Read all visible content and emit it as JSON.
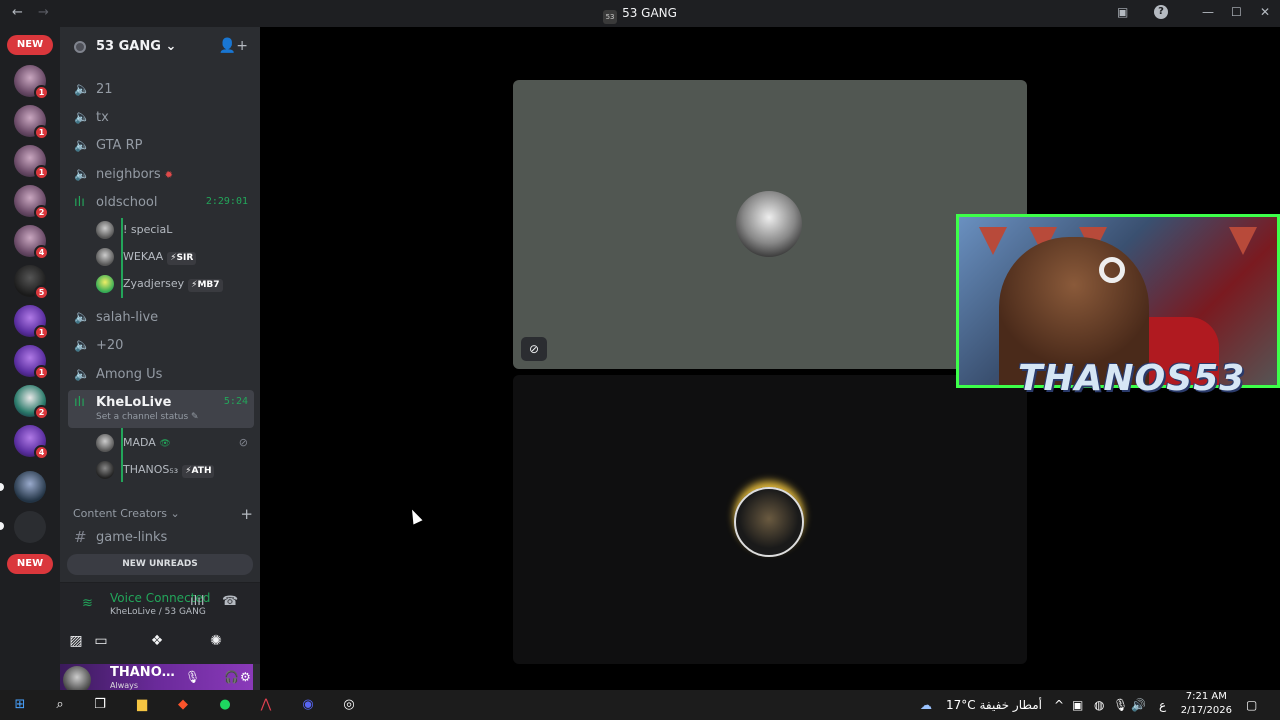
{
  "window": {
    "title": "53 GANG",
    "title_glyph": "53",
    "back": "←",
    "forward": "→",
    "minimize": "—",
    "maximize": "☐",
    "close": "✕",
    "inbox_icon": "▣",
    "help_icon": "?"
  },
  "guilds": {
    "new_label": "NEW",
    "badges": [
      "1",
      "1",
      "1",
      "2",
      "4",
      "5",
      "1",
      "1",
      "2",
      "4"
    ]
  },
  "server": {
    "name": "53 GANG",
    "caret": "⌄",
    "invite_icon": "👤+"
  },
  "channels": [
    {
      "name": "21"
    },
    {
      "name": "tx"
    },
    {
      "name": "GTA RP"
    },
    {
      "name": "neighbors",
      "emoji": "✹"
    },
    {
      "name": "oldschool",
      "timer": "2:29:01",
      "live": true
    },
    {
      "name": "salah-live"
    },
    {
      "name": "+20"
    },
    {
      "name": "Among Us"
    },
    {
      "name": "KheLoLive",
      "timer": "5:24",
      "live": true,
      "status": "Set a channel status ✎"
    }
  ],
  "oldschool_users": [
    {
      "name": "! speciaL",
      "tag": ""
    },
    {
      "name": "WEKAA",
      "tag": "⚡SIR"
    },
    {
      "name": "Zyadjersey",
      "tag": "⚡MB7"
    }
  ],
  "khelolive_users": [
    {
      "name": "MADA",
      "suffix": "👁",
      "tag": "",
      "muted": true
    },
    {
      "name": "THANOS₅₃",
      "tag": "⚡ATH"
    }
  ],
  "category": {
    "name": "Content Creators ⌄",
    "plus": "+"
  },
  "game_links": {
    "name": "game-links"
  },
  "new_unreads": "NEW UNREADS",
  "voice": {
    "status": "Voice Connected",
    "location": "KheLoLive / 53 GANG",
    "signal_icon": "≋",
    "soundboard_icon": "ılıl",
    "disconnect_icon": "☎",
    "camera_icon": "▨",
    "screen_icon": "▭",
    "activity_icon": "❖",
    "sound_icon": "✺"
  },
  "user": {
    "name": "THANO…",
    "status": "Always",
    "mic_icon": "🎙",
    "headphone_icon": "🎧",
    "settings_icon": "⚙"
  },
  "stage": {
    "mute_icon": "⊘",
    "cam_overlay": "THANOS53"
  },
  "taskbar": {
    "weather": "17°C أمطار خفيفة",
    "lang": "ع",
    "time": "7:21 AM",
    "date": "2/17/2026",
    "tray_chevron": "^"
  }
}
